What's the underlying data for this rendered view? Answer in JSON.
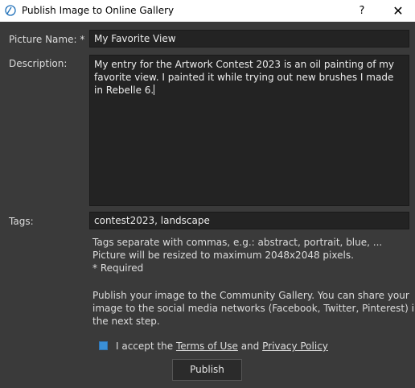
{
  "window": {
    "title": "Publish Image to Online Gallery",
    "help_label": "?",
    "close_label": "✕"
  },
  "form": {
    "name_label": "Picture Name: *",
    "name_value": "My Favorite View",
    "description_label": "Description:",
    "description_value": "My entry for the Artwork Contest 2023 is an oil painting of my favorite view. I painted it while trying out new brushes I made in Rebelle 6.",
    "tags_label": "Tags:",
    "tags_value": "contest2023, landscape"
  },
  "info": {
    "line1": "Tags separate with commas, e.g.: abstract, portrait, blue, ...",
    "line2": "Picture will be resized to maximum 2048x2048 pixels.",
    "line3": "* Required",
    "publish_note_1": "Publish your image to the Community Gallery. You can share your",
    "publish_note_2": "image to the social media networks (Facebook, Twitter, Pinterest) in",
    "publish_note_3": "the next step."
  },
  "consent": {
    "checked": true,
    "prefix": "I accept the ",
    "terms_link": "Terms of Use",
    "and": " and ",
    "privacy_link": "Privacy Policy"
  },
  "actions": {
    "publish_label": "Publish"
  },
  "colors": {
    "background": "#3a3a3a",
    "field_background": "#232323",
    "checkbox_accent": "#3a8fd6"
  }
}
